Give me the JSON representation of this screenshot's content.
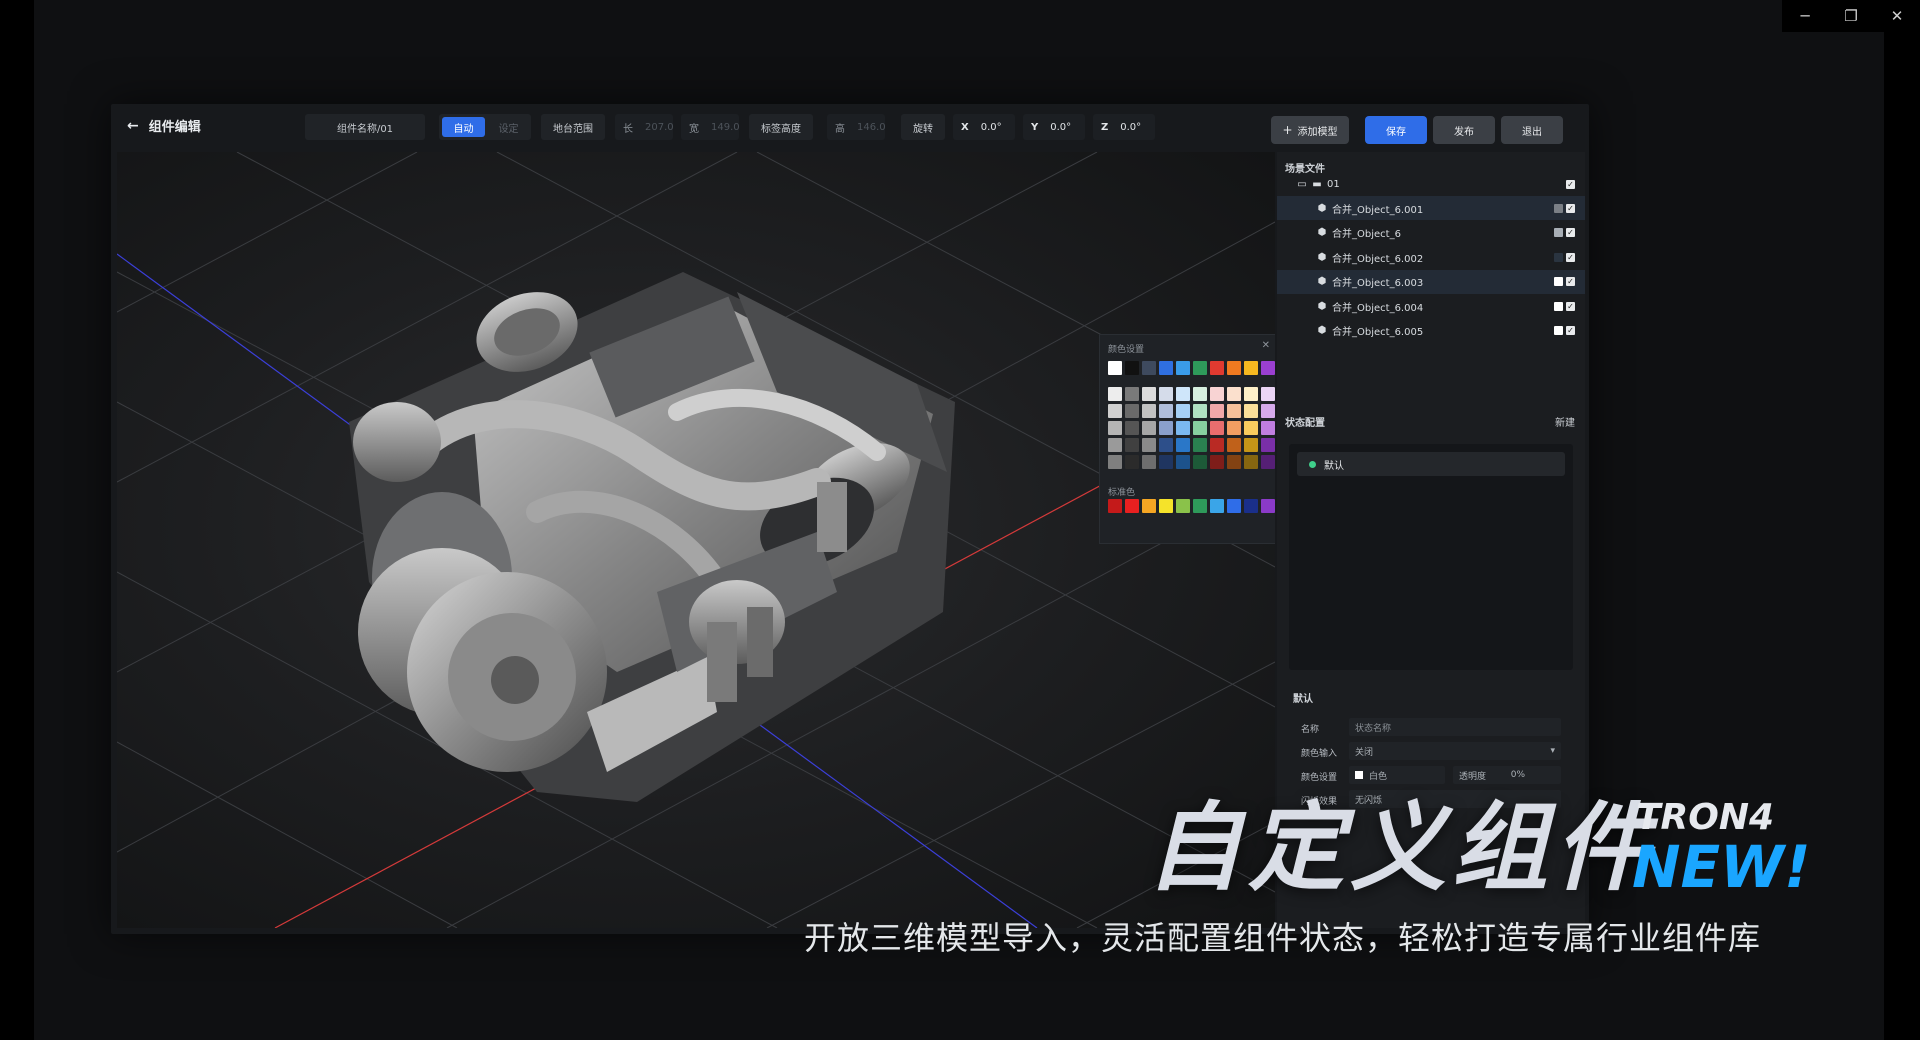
{
  "window": {
    "minimize_glyph": "─",
    "restore_glyph": "❐",
    "close_glyph": "✕"
  },
  "header": {
    "title": "组件编辑",
    "component_name": "组件名称/01",
    "mode_auto": "自动",
    "mode_set": "设定",
    "platform_range": "地台范围",
    "length_label": "长",
    "length_value": "207.0",
    "width_label": "宽",
    "width_value": "149.0",
    "tag_height_label": "标签高度",
    "height_label": "高",
    "height_value": "146.0",
    "rotate_label": "旋转",
    "x_label": "X",
    "x_value": "0.0°",
    "y_label": "Y",
    "y_value": "0.0°",
    "z_label": "Z",
    "z_value": "0.0°",
    "add_model": "添加模型",
    "save": "保存",
    "publish": "发布",
    "exit": "退出"
  },
  "color_picker": {
    "title": "颜色设置",
    "standard_label": "标准色",
    "close_glyph": "✕",
    "top_row": [
      "#ffffff",
      "#111111",
      "#3e4a5e",
      "#2f6fe0",
      "#3a9be8",
      "#2e9a5a",
      "#e03a30",
      "#f07a20",
      "#f5b820",
      "#9a3fd0"
    ],
    "grid": [
      [
        "#ededed",
        "#7a7a7a",
        "#dcdcdc",
        "#d5dcea",
        "#cfe6fa",
        "#d7f0e0",
        "#f8d3d3",
        "#fbe0cd",
        "#fdf0c8",
        "#ebd5f5"
      ],
      [
        "#d0d0d0",
        "#6a6a6a",
        "#c2c2c2",
        "#b0bedb",
        "#a6d0f5",
        "#b1e1c2",
        "#f1a8a8",
        "#f7c19a",
        "#fbe09a",
        "#d6aaeb"
      ],
      [
        "#b5b5b5",
        "#555555",
        "#a6a6a6",
        "#8aa0cc",
        "#7bb9f0",
        "#87d0a0",
        "#e86e6e",
        "#f39e62",
        "#f8cc5e",
        "#c07ee0"
      ],
      [
        "#9a9a9a",
        "#404040",
        "#8a8a8a",
        "#2d4f8a",
        "#2a77c8",
        "#2a8050",
        "#b92a24",
        "#c0611a",
        "#c49518",
        "#7a2fa8"
      ],
      [
        "#7f7f7f",
        "#2b2b2b",
        "#6e6e6e",
        "#1f3560",
        "#1c528c",
        "#1d5a38",
        "#7e1d19",
        "#834212",
        "#866610",
        "#551f75"
      ]
    ],
    "standard": [
      "#c41a1a",
      "#e82020",
      "#f5a623",
      "#f5e32a",
      "#8ac24a",
      "#2e9a5a",
      "#3aa5e8",
      "#2f6de8",
      "#1a2f8a",
      "#8a3ac8"
    ]
  },
  "scene": {
    "title": "场景文件",
    "root": "01",
    "items": [
      {
        "label": "合并_Object_6.001",
        "swatch": "#7a7f86",
        "selected": true
      },
      {
        "label": "合并_Object_6",
        "swatch": "#a8aeb5",
        "selected": false
      },
      {
        "label": "合并_Object_6.002",
        "swatch": "#2a3440",
        "selected": false
      },
      {
        "label": "合并_Object_6.003",
        "swatch": "#ffffff",
        "selected": true
      },
      {
        "label": "合并_Object_6.004",
        "swatch": "#ffffff",
        "selected": false
      },
      {
        "label": "合并_Object_6.005",
        "swatch": "#ffffff",
        "selected": false
      }
    ]
  },
  "state": {
    "title": "状态配置",
    "new_label": "新建",
    "default_item": "默认",
    "section_label": "默认",
    "name_label": "名称",
    "name_placeholder": "状态名称",
    "color_input_label": "颜色输入",
    "color_input_value": "关闭",
    "color_setting_label": "颜色设置",
    "color_value": "白色",
    "opacity_label": "透明度",
    "opacity_value": "0%",
    "flash_label": "闪烁效果",
    "flash_value": "无闪烁"
  },
  "promo": {
    "title": "自定义组件",
    "brand": "TRON4",
    "badge": "NEW!",
    "subtitle": "开放三维模型导入，灵活配置组件状态，轻松打造专属行业组件库"
  }
}
